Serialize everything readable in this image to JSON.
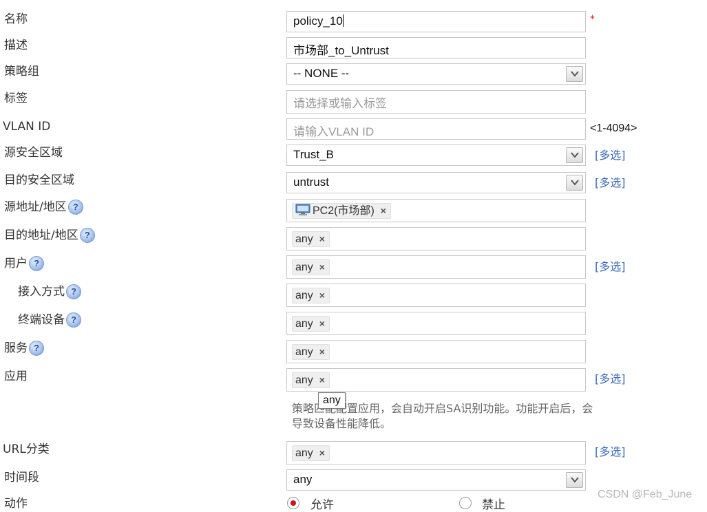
{
  "labels": {
    "name": "名称",
    "desc": "描述",
    "policy_group": "策略组",
    "tag": "标签",
    "vlan": "VLAN ID",
    "src_zone": "源安全区域",
    "dst_zone": "目的安全区域",
    "src_addr": "源地址/地区",
    "dst_addr": "目的地址/地区",
    "user": "用户",
    "access_mode": "接入方式",
    "terminal": "终端设备",
    "service": "服务",
    "app": "应用",
    "url": "URL分类",
    "time": "时间段",
    "action": "动作"
  },
  "fields": {
    "name_value": "policy_10",
    "name_required": "*",
    "desc_value": "市场部_to_Untrust",
    "policy_group_value": "-- NONE --",
    "tag_placeholder": "请选择或输入标签",
    "vlan_placeholder": "请输入VLAN ID",
    "vlan_range": "<1-4094>",
    "src_zone_value": "Trust_B",
    "dst_zone_value": "untrust",
    "src_addr_tag": "PC2(市场部)",
    "dst_addr_tag": "any",
    "user_tag": "any",
    "access_mode_tag": "any",
    "terminal_tag": "any",
    "service_tag": "any",
    "app_tag": "any",
    "url_tag": "any",
    "time_value": "any"
  },
  "tag_remove": "×",
  "help_mark": "?",
  "multi_select": "[多选]",
  "app_note": "策略匹配配置应用，会自动开启SA识别功能。功能开启后，会导致设备性能降低。",
  "tooltip": "any",
  "action": {
    "allow": "允许",
    "deny": "禁止",
    "selected": "allow"
  },
  "watermark": "CSDN @Feb_June"
}
